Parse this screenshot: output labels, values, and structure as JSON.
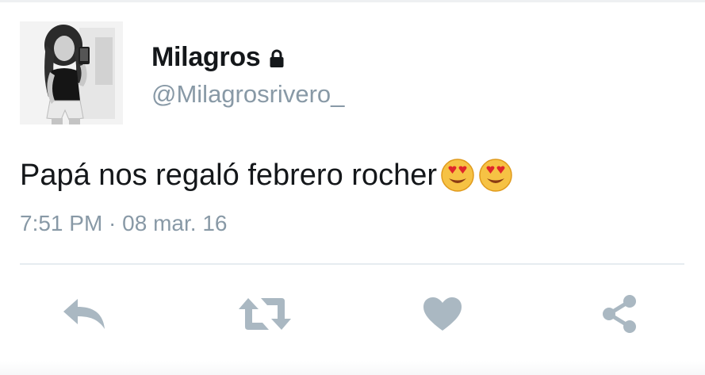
{
  "tweet": {
    "user_name": "Milagros",
    "user_handle": "@Milagrosrivero_",
    "text": "Papá nos regaló febrero rocher",
    "emojis": [
      "heart-eyes-emoji",
      "heart-eyes-emoji"
    ],
    "timestamp": "7:51 PM · 08 mar. 16",
    "protected": true
  },
  "actions": {
    "icons": [
      "reply-icon",
      "retweet-icon",
      "heart-icon",
      "share-icon"
    ]
  },
  "colors": {
    "text_primary": "#14171a",
    "text_secondary": "#8899a6",
    "icon_gray": "#aab8c2",
    "divider": "#e6ecf0"
  }
}
